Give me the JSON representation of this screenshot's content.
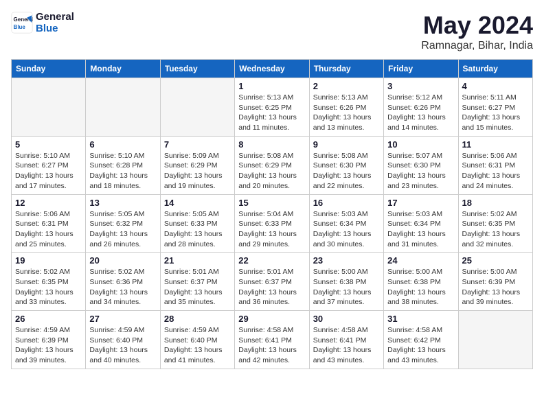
{
  "logo": {
    "line1": "General",
    "line2": "Blue"
  },
  "title": "May 2024",
  "location": "Ramnagar, Bihar, India",
  "weekdays": [
    "Sunday",
    "Monday",
    "Tuesday",
    "Wednesday",
    "Thursday",
    "Friday",
    "Saturday"
  ],
  "weeks": [
    [
      {
        "day": "",
        "info": ""
      },
      {
        "day": "",
        "info": ""
      },
      {
        "day": "",
        "info": ""
      },
      {
        "day": "1",
        "info": "Sunrise: 5:13 AM\nSunset: 6:25 PM\nDaylight: 13 hours\nand 11 minutes."
      },
      {
        "day": "2",
        "info": "Sunrise: 5:13 AM\nSunset: 6:26 PM\nDaylight: 13 hours\nand 13 minutes."
      },
      {
        "day": "3",
        "info": "Sunrise: 5:12 AM\nSunset: 6:26 PM\nDaylight: 13 hours\nand 14 minutes."
      },
      {
        "day": "4",
        "info": "Sunrise: 5:11 AM\nSunset: 6:27 PM\nDaylight: 13 hours\nand 15 minutes."
      }
    ],
    [
      {
        "day": "5",
        "info": "Sunrise: 5:10 AM\nSunset: 6:27 PM\nDaylight: 13 hours\nand 17 minutes."
      },
      {
        "day": "6",
        "info": "Sunrise: 5:10 AM\nSunset: 6:28 PM\nDaylight: 13 hours\nand 18 minutes."
      },
      {
        "day": "7",
        "info": "Sunrise: 5:09 AM\nSunset: 6:29 PM\nDaylight: 13 hours\nand 19 minutes."
      },
      {
        "day": "8",
        "info": "Sunrise: 5:08 AM\nSunset: 6:29 PM\nDaylight: 13 hours\nand 20 minutes."
      },
      {
        "day": "9",
        "info": "Sunrise: 5:08 AM\nSunset: 6:30 PM\nDaylight: 13 hours\nand 22 minutes."
      },
      {
        "day": "10",
        "info": "Sunrise: 5:07 AM\nSunset: 6:30 PM\nDaylight: 13 hours\nand 23 minutes."
      },
      {
        "day": "11",
        "info": "Sunrise: 5:06 AM\nSunset: 6:31 PM\nDaylight: 13 hours\nand 24 minutes."
      }
    ],
    [
      {
        "day": "12",
        "info": "Sunrise: 5:06 AM\nSunset: 6:31 PM\nDaylight: 13 hours\nand 25 minutes."
      },
      {
        "day": "13",
        "info": "Sunrise: 5:05 AM\nSunset: 6:32 PM\nDaylight: 13 hours\nand 26 minutes."
      },
      {
        "day": "14",
        "info": "Sunrise: 5:05 AM\nSunset: 6:33 PM\nDaylight: 13 hours\nand 28 minutes."
      },
      {
        "day": "15",
        "info": "Sunrise: 5:04 AM\nSunset: 6:33 PM\nDaylight: 13 hours\nand 29 minutes."
      },
      {
        "day": "16",
        "info": "Sunrise: 5:03 AM\nSunset: 6:34 PM\nDaylight: 13 hours\nand 30 minutes."
      },
      {
        "day": "17",
        "info": "Sunrise: 5:03 AM\nSunset: 6:34 PM\nDaylight: 13 hours\nand 31 minutes."
      },
      {
        "day": "18",
        "info": "Sunrise: 5:02 AM\nSunset: 6:35 PM\nDaylight: 13 hours\nand 32 minutes."
      }
    ],
    [
      {
        "day": "19",
        "info": "Sunrise: 5:02 AM\nSunset: 6:35 PM\nDaylight: 13 hours\nand 33 minutes."
      },
      {
        "day": "20",
        "info": "Sunrise: 5:02 AM\nSunset: 6:36 PM\nDaylight: 13 hours\nand 34 minutes."
      },
      {
        "day": "21",
        "info": "Sunrise: 5:01 AM\nSunset: 6:37 PM\nDaylight: 13 hours\nand 35 minutes."
      },
      {
        "day": "22",
        "info": "Sunrise: 5:01 AM\nSunset: 6:37 PM\nDaylight: 13 hours\nand 36 minutes."
      },
      {
        "day": "23",
        "info": "Sunrise: 5:00 AM\nSunset: 6:38 PM\nDaylight: 13 hours\nand 37 minutes."
      },
      {
        "day": "24",
        "info": "Sunrise: 5:00 AM\nSunset: 6:38 PM\nDaylight: 13 hours\nand 38 minutes."
      },
      {
        "day": "25",
        "info": "Sunrise: 5:00 AM\nSunset: 6:39 PM\nDaylight: 13 hours\nand 39 minutes."
      }
    ],
    [
      {
        "day": "26",
        "info": "Sunrise: 4:59 AM\nSunset: 6:39 PM\nDaylight: 13 hours\nand 39 minutes."
      },
      {
        "day": "27",
        "info": "Sunrise: 4:59 AM\nSunset: 6:40 PM\nDaylight: 13 hours\nand 40 minutes."
      },
      {
        "day": "28",
        "info": "Sunrise: 4:59 AM\nSunset: 6:40 PM\nDaylight: 13 hours\nand 41 minutes."
      },
      {
        "day": "29",
        "info": "Sunrise: 4:58 AM\nSunset: 6:41 PM\nDaylight: 13 hours\nand 42 minutes."
      },
      {
        "day": "30",
        "info": "Sunrise: 4:58 AM\nSunset: 6:41 PM\nDaylight: 13 hours\nand 43 minutes."
      },
      {
        "day": "31",
        "info": "Sunrise: 4:58 AM\nSunset: 6:42 PM\nDaylight: 13 hours\nand 43 minutes."
      },
      {
        "day": "",
        "info": ""
      }
    ]
  ]
}
